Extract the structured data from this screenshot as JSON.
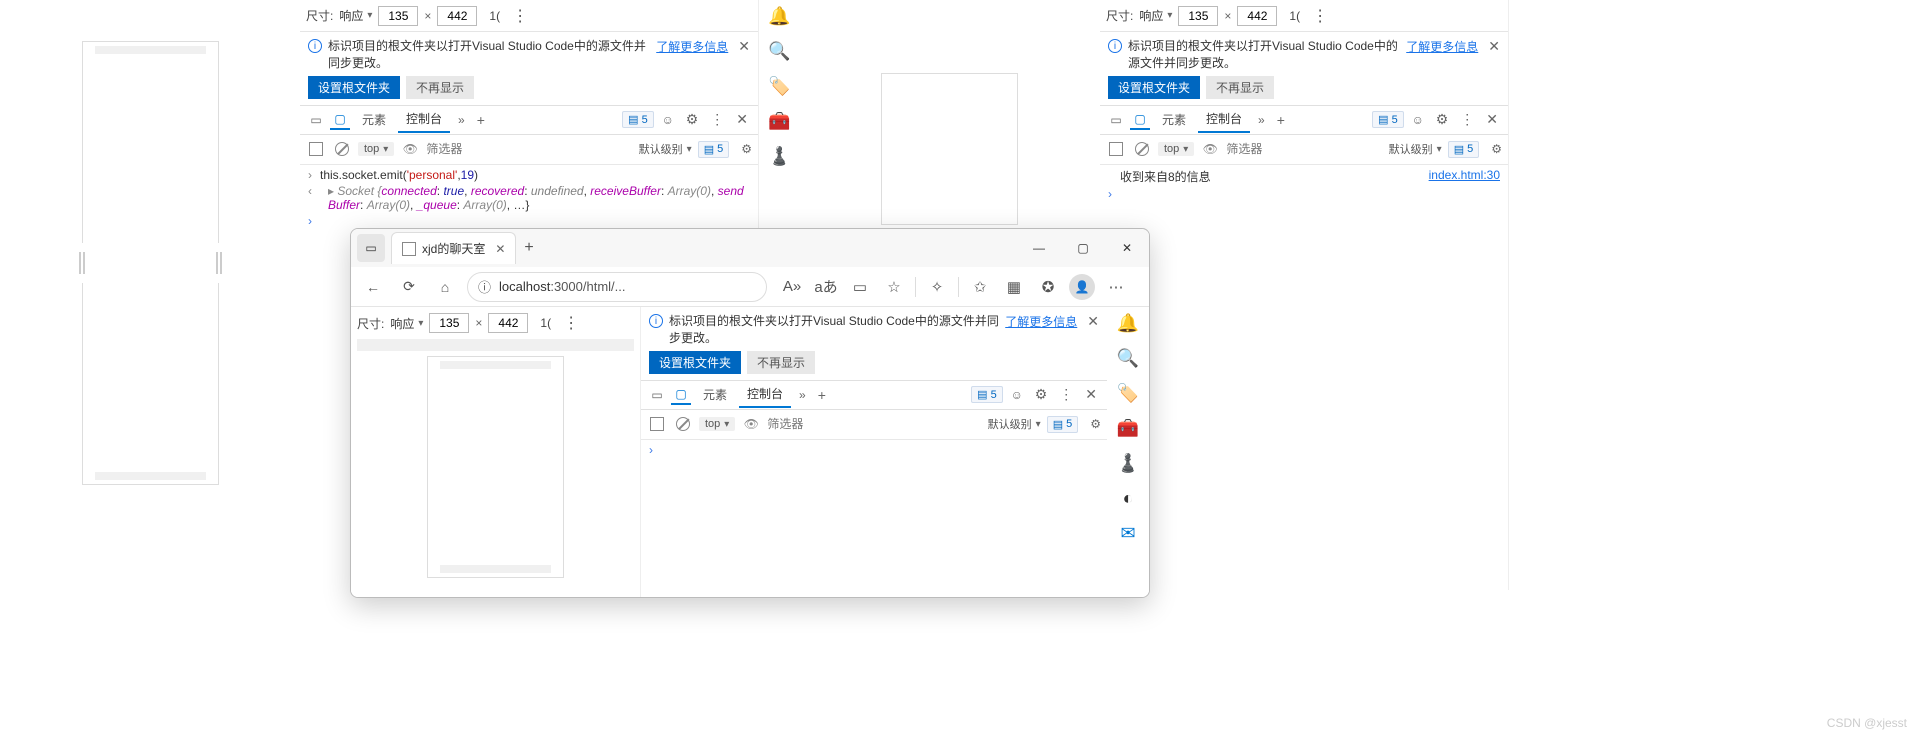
{
  "dim": {
    "label": "尺寸:",
    "mode": "响应",
    "w": "135",
    "h": "442",
    "zoom": "1("
  },
  "notice": {
    "text": "标识项目的根文件夹以打开Visual Studio Code中的源文件并同步更改。",
    "link": "了解更多信息",
    "btn_primary": "设置根文件夹",
    "btn_secondary": "不再显示"
  },
  "tabs": {
    "elements": "元素",
    "console": "控制台"
  },
  "console_toolbar": {
    "ctx": "top",
    "filter_ph": "筛选器",
    "level": "默认级别"
  },
  "pane1": {
    "issues_count": "5",
    "sidebar_count": "5",
    "code_html": "this.socket.<span class='code-method'>emit</span>(<span class='code-str'>'personal'</span>,<span class='code-num'>19</span>)",
    "obj_html": "<span class='obj-name'>Socket {</span><span class='obj-prop'>connected</span>: <span class='obj-val-true'>true</span>, <span class='obj-prop'>recovered</span>: <span class='obj-val-undef'>undefined</span>, <span class='obj-prop'>receiveBuffer</span>: <span class='obj-name'>Array(0)</span>, <span class='obj-prop'>sendBuffer</span>: <span class='obj-name'>Array(0)</span>, <span class='obj-prop'>_queue</span>: <span class='obj-name'>Array(0)</span>, …}"
  },
  "pane2": {
    "issues_count": "5",
    "sidebar_count": "5",
    "msg": "收到来自8的信息",
    "src": "index.html:30"
  },
  "popup": {
    "tab_title": "xjd的聊天室",
    "url_prefix": "localhost",
    "url_rest": ":3000/html/...",
    "issues_count": "5",
    "sidebar_count": "5"
  },
  "watermark": "CSDN @xjesst"
}
